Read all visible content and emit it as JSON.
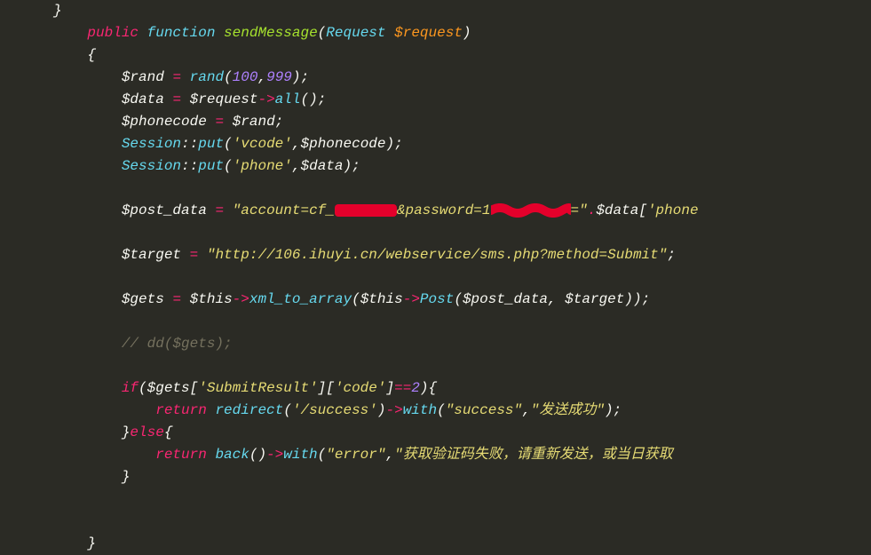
{
  "code": {
    "l0": "}",
    "l1_pub": "public",
    "l1_func": "function",
    "l1_name": "sendMessage",
    "l1_type": "Request",
    "l1_param": "$request",
    "l2": "{",
    "l3_var": "$rand",
    "l3_fn": "rand",
    "l3_n1": "100",
    "l3_n2": "999",
    "l4_var": "$data",
    "l4_rhs": "$request",
    "l4_fn": "all",
    "l5_var": "$phonecode",
    "l5_rhs": "$rand",
    "l6_cls": "Session",
    "l6_fn": "put",
    "l6_s1": "'vcode'",
    "l6_v": "$phonecode",
    "l7_cls": "Session",
    "l7_fn": "put",
    "l7_s1": "'phone'",
    "l7_v": "$data",
    "l8_var": "$post_data",
    "l8_s1": "\"account=cf_",
    "l8_s2": "&password=1",
    "l8_s3": "=\"",
    "l8_v": "$data",
    "l8_idx": "'phone",
    "l9_var": "$target",
    "l9_s": "\"http://106.ihuyi.cn/webservice/sms.php?method=Submit\"",
    "l10_var": "$gets",
    "l10_this": "$this",
    "l10_fn1": "xml_to_array",
    "l10_fn2": "Post",
    "l10_a1": "$post_data",
    "l10_a2": "$target",
    "l11_comment": "// dd($gets);",
    "l12_if": "if",
    "l12_var": "$gets",
    "l12_k1": "'SubmitResult'",
    "l12_k2": "'code'",
    "l12_n": "2",
    "l13_ret": "return",
    "l13_fn": "redirect",
    "l13_s1": "'/success'",
    "l13_fn2": "with",
    "l13_s2": "\"success\"",
    "l13_s3": "\"发送成功\"",
    "l14": "}",
    "l14_else": "else",
    "l14b": "{",
    "l15_ret": "return",
    "l15_fn": "back",
    "l15_fn2": "with",
    "l15_s1": "\"error\"",
    "l15_s2": "\"获取验证码失败，请重新发送，或当日获取",
    "l16": "}",
    "l17": "}"
  }
}
